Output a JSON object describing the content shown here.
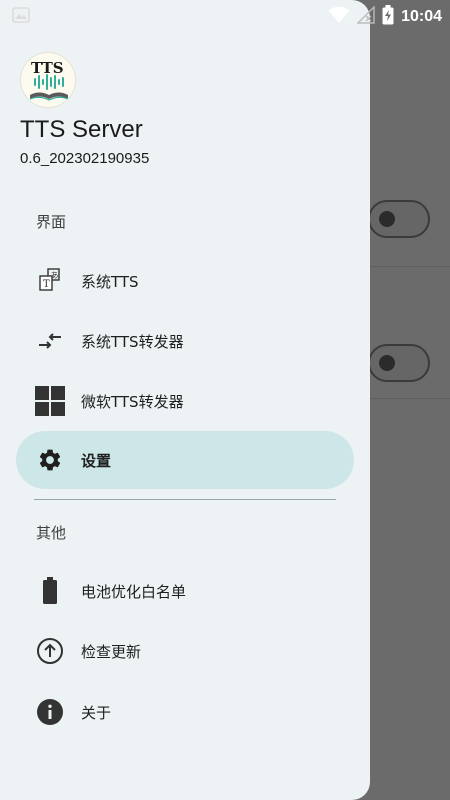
{
  "status_bar": {
    "time": "10:04"
  },
  "drawer": {
    "app_name": "TTS Server",
    "version": "0.6_202302190935",
    "logo_text": "TTS",
    "section_interface": "界面",
    "section_other": "其他",
    "items": [
      {
        "label": "系统TTS",
        "icon": "system-tts-icon"
      },
      {
        "label": "系统TTS转发器",
        "icon": "forward-arrows-icon"
      },
      {
        "label": "微软TTS转发器",
        "icon": "windows-grid-icon"
      },
      {
        "label": "设置",
        "icon": "gear-icon",
        "active": true
      },
      {
        "label": "电池优化白名单",
        "icon": "battery-icon"
      },
      {
        "label": "检查更新",
        "icon": "upload-circle-icon"
      },
      {
        "label": "关于",
        "icon": "info-icon"
      }
    ]
  },
  "colors": {
    "drawer_bg": "#edf3f4",
    "active_item_bg": "#cde6e7",
    "scrim": "#6b6b6b"
  }
}
